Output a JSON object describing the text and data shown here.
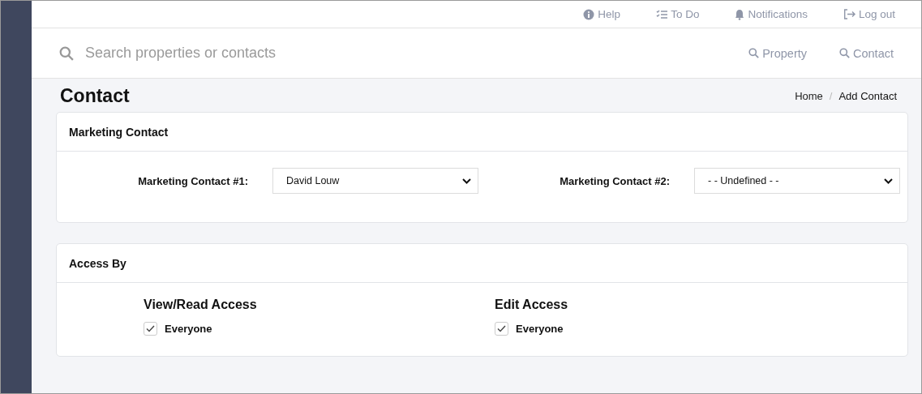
{
  "top_links": [
    {
      "kind": "help",
      "label": "Help"
    },
    {
      "kind": "todo",
      "label": "To Do"
    },
    {
      "kind": "bell",
      "label": "Notifications"
    },
    {
      "kind": "logout",
      "label": "Log out"
    }
  ],
  "search": {
    "placeholder": "Search properties or contacts"
  },
  "search_links": [
    {
      "label": "Property"
    },
    {
      "label": "Contact"
    }
  ],
  "page_title": "Contact",
  "breadcrumb_separator": "/",
  "breadcrumb": [
    {
      "label": "Home",
      "current": false
    },
    {
      "label": "Add Contact",
      "current": true
    }
  ],
  "marketing": {
    "title": "Marketing Contact",
    "fields": [
      {
        "label": "Marketing Contact #1:",
        "value": "David Louw"
      },
      {
        "label": "Marketing Contact #2:",
        "value": "- - Undefined - -"
      }
    ]
  },
  "access": {
    "title": "Access By",
    "groups": [
      {
        "title": "View/Read Access",
        "options": [
          {
            "label": "Everyone",
            "checked": true
          }
        ]
      },
      {
        "title": "Edit Access",
        "options": [
          {
            "label": "Everyone",
            "checked": true
          }
        ]
      }
    ]
  }
}
